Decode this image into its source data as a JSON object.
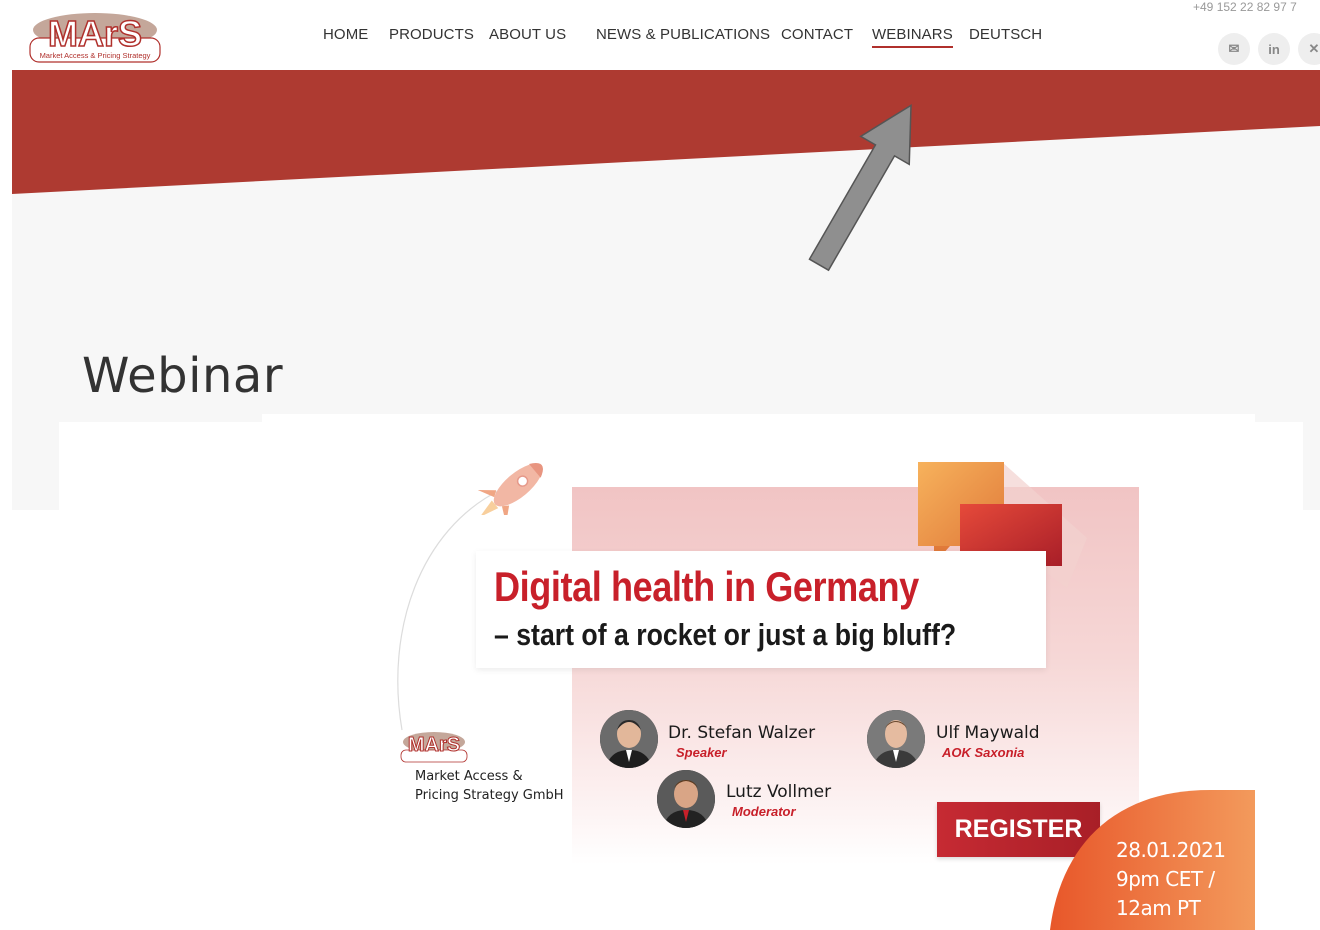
{
  "header": {
    "logo_text": "MArS",
    "logo_tagline": "Market Access & Pricing Strategy",
    "nav": [
      {
        "label": "HOME"
      },
      {
        "label": "PRODUCTS"
      },
      {
        "label": "ABOUT US"
      },
      {
        "label": "NEWS & PUBLICATIONS"
      },
      {
        "label": "CONTACT"
      },
      {
        "label": "WEBINARS",
        "active": true
      },
      {
        "label": "DEUTSCH"
      }
    ],
    "phone": "+49 152 22 82 97 7",
    "social": [
      {
        "icon": "envelope-icon",
        "glyph": "✉"
      },
      {
        "icon": "linkedin-icon",
        "glyph": "in"
      },
      {
        "icon": "xing-icon",
        "glyph": "✕"
      }
    ]
  },
  "page": {
    "title": "Webinar"
  },
  "banner": {
    "headline": "Digital health in Germany",
    "subheadline": "– start of a rocket or just a big bluff?",
    "company_logo": "MArS",
    "company_name_line1": "Market Access &",
    "company_name_line2": "Pricing Strategy GmbH",
    "people": [
      {
        "name": "Dr. Stefan Walzer",
        "role": "Speaker"
      },
      {
        "name": "Ulf Maywald",
        "role": "AOK Saxonia"
      },
      {
        "name": "Lutz Vollmer",
        "role": "Moderator"
      }
    ],
    "register_label": "REGISTER",
    "date_line1": "28.01.2021",
    "date_line2": "9pm CET /",
    "date_line3": "12am PT"
  },
  "colors": {
    "brand_red": "#b0302c",
    "headline_red": "#c8202a",
    "orange": "#ee8a45"
  }
}
